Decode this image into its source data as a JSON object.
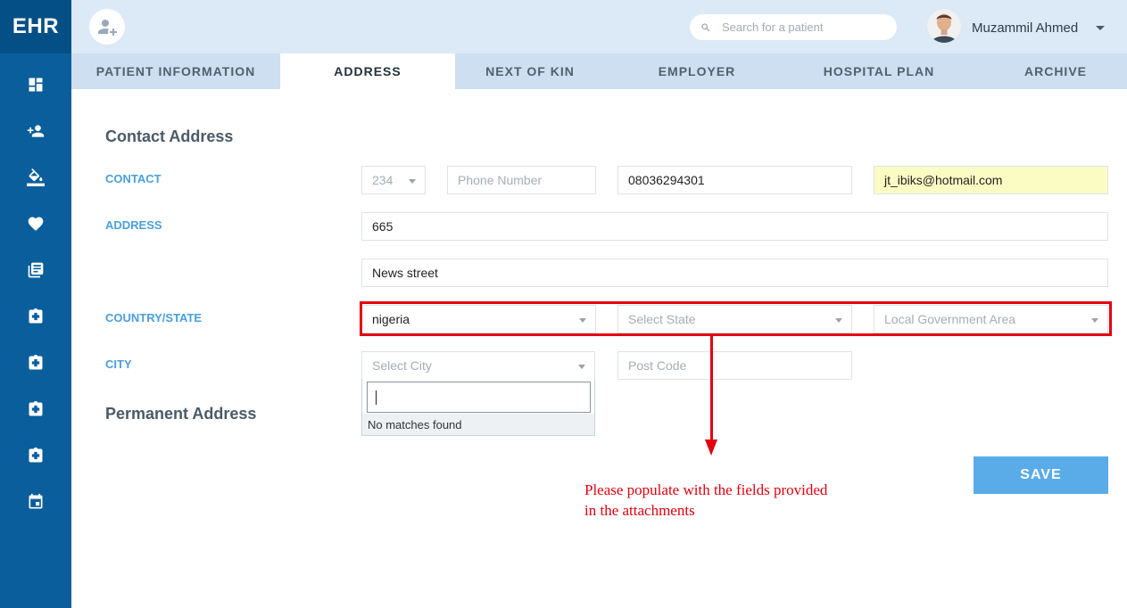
{
  "app": {
    "brand": "EHR"
  },
  "sidebar": {
    "items": [
      {
        "icon": "dashboard-icon"
      },
      {
        "icon": "add-person-icon"
      },
      {
        "icon": "paint-bucket-icon"
      },
      {
        "icon": "heart-icon"
      },
      {
        "icon": "library-books-icon"
      },
      {
        "icon": "medical-record-icon"
      },
      {
        "icon": "medical-record-icon"
      },
      {
        "icon": "medical-record-icon"
      },
      {
        "icon": "medical-record-icon"
      },
      {
        "icon": "calendar-icon"
      }
    ]
  },
  "topbar": {
    "search_placeholder": "Search for a patient",
    "user_name": "Muzammil Ahmed"
  },
  "tabs": [
    {
      "label": "PATIENT INFORMATION",
      "active": false
    },
    {
      "label": "ADDRESS",
      "active": true
    },
    {
      "label": "NEXT OF KIN",
      "active": false
    },
    {
      "label": "EMPLOYER",
      "active": false
    },
    {
      "label": "HOSPITAL PLAN",
      "active": false
    },
    {
      "label": "ARCHIVE",
      "active": false
    }
  ],
  "form": {
    "contact_address_title": "Contact Address",
    "permanent_address_title": "Permanent Address",
    "labels": {
      "contact": "CONTACT",
      "address": "ADDRESS",
      "country_state": "COUNTRY/STATE",
      "city": "CITY"
    },
    "contact": {
      "country_code": "234",
      "phone_placeholder": "Phone Number",
      "phone_value": "08036294301",
      "email_value": "jt_ibiks@hotmail.com"
    },
    "address": {
      "line1": "665",
      "line2": "News street"
    },
    "country_state": {
      "country": "nigeria",
      "state_placeholder": "Select State",
      "lga_placeholder": "Local Government Area"
    },
    "city": {
      "city_placeholder": "Select City",
      "postcode_placeholder": "Post Code",
      "dropdown_empty_text": "No matches found"
    },
    "save_label": "SAVE"
  },
  "annotation": {
    "line1": "Please populate with the fields provided",
    "line2": "in the attachments",
    "color": "#e3000f"
  }
}
